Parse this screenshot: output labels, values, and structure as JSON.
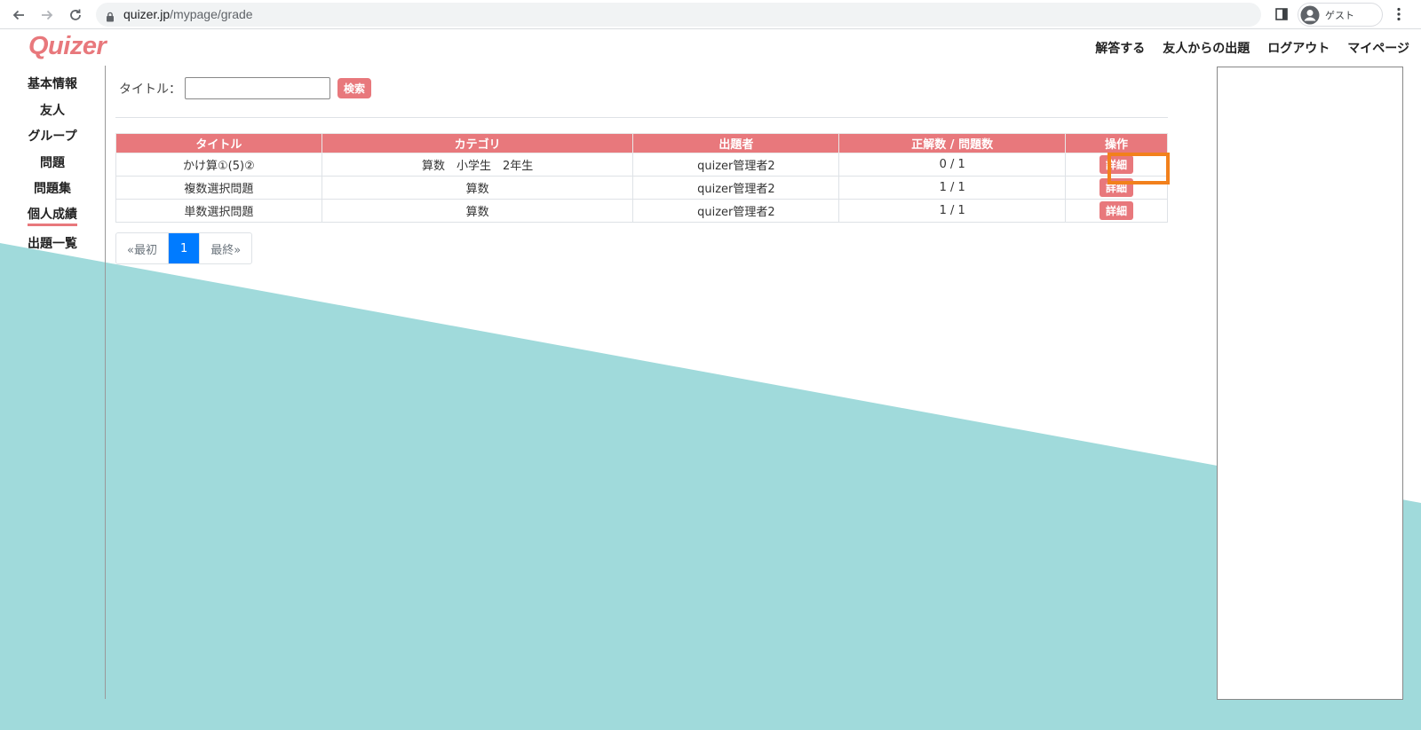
{
  "browser": {
    "url_host": "quizer.jp",
    "url_path": "/mypage/grade",
    "profile_label": "ゲスト"
  },
  "site": {
    "logo": "Quizer",
    "topnav": [
      "解答する",
      "友人からの出題",
      "ログアウト",
      "マイページ"
    ]
  },
  "sidebar": {
    "items": [
      "基本情報",
      "友人",
      "グループ",
      "問題",
      "問題集",
      "個人成績",
      "出題一覧"
    ],
    "active": "個人成績"
  },
  "search": {
    "label": "タイトル：",
    "value": "",
    "button": "検索"
  },
  "table": {
    "headers": [
      "タイトル",
      "カテゴリ",
      "出題者",
      "正解数 / 問題数",
      "操作"
    ],
    "rows": [
      {
        "title": "かけ算①(5)②",
        "category": "算数　小学生　2年生",
        "author": "quizer管理者2",
        "score": "0 / 1",
        "action": "詳細"
      },
      {
        "title": "複数選択問題",
        "category": "算数",
        "author": "quizer管理者2",
        "score": "1 / 1",
        "action": "詳細"
      },
      {
        "title": "単数選択問題",
        "category": "算数",
        "author": "quizer管理者2",
        "score": "1 / 1",
        "action": "詳細"
      }
    ]
  },
  "pagination": {
    "first": "«最初",
    "current": "1",
    "last": "最終»"
  },
  "colors": {
    "accent": "#e8787c",
    "teal": "#a0dadb",
    "highlight": "#f2801c",
    "page_active": "#007bff"
  }
}
